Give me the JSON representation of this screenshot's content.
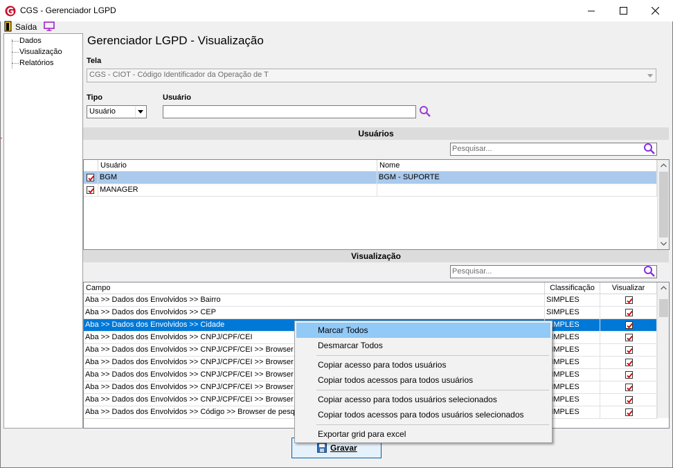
{
  "window": {
    "title": "CGS - Gerenciador LGPD"
  },
  "menu": {
    "exit_label": "Saída"
  },
  "tree": {
    "items": [
      "Dados",
      "Visualização",
      "Relatórios"
    ]
  },
  "page": {
    "title": "Gerenciador LGPD - Visualização"
  },
  "tela": {
    "label": "Tela",
    "value": "CGS - CIOT - Código Identificador da Operação de T"
  },
  "tipo": {
    "label": "Tipo",
    "value": "Usuário"
  },
  "usuario": {
    "label": "Usuário",
    "value": ""
  },
  "users_section": {
    "title": "Usuários",
    "search_placeholder": "Pesquisar...",
    "columns": [
      "Usuário",
      "Nome"
    ],
    "rows": [
      {
        "checked": true,
        "user": "BGM",
        "name": "BGM - SUPORTE"
      },
      {
        "checked": true,
        "user": "MANAGER",
        "name": ""
      }
    ]
  },
  "view_section": {
    "title": "Visualização",
    "search_placeholder": "Pesquisar...",
    "columns": [
      "Campo",
      "Classificação",
      "Visualizar"
    ],
    "rows": [
      {
        "campo": "Aba >> Dados dos Envolvidos >> Bairro",
        "classificacao": "SIMPLES",
        "visualizar": true
      },
      {
        "campo": "Aba >> Dados dos Envolvidos >> CEP",
        "classificacao": "SIMPLES",
        "visualizar": true
      },
      {
        "campo": "Aba >> Dados dos Envolvidos >> Cidade",
        "classificacao": "SIMPLES",
        "visualizar": true
      },
      {
        "campo": "Aba >> Dados dos Envolvidos >> CNPJ/CPF/CEI",
        "classificacao": "SIMPLES",
        "visualizar": true
      },
      {
        "campo": "Aba >> Dados dos Envolvidos >> CNPJ/CPF/CEI >> Browser de",
        "classificacao": "SIMPLES",
        "visualizar": true
      },
      {
        "campo": "Aba >> Dados dos Envolvidos >> CNPJ/CPF/CEI >> Browser de",
        "classificacao": "SIMPLES",
        "visualizar": true
      },
      {
        "campo": "Aba >> Dados dos Envolvidos >> CNPJ/CPF/CEI >> Browser de",
        "classificacao": "SIMPLES",
        "visualizar": true
      },
      {
        "campo": "Aba >> Dados dos Envolvidos >> CNPJ/CPF/CEI >> Browser de",
        "classificacao": "SIMPLES",
        "visualizar": true
      },
      {
        "campo": "Aba >> Dados dos Envolvidos >> CNPJ/CPF/CEI >> Browser de",
        "classificacao": "SIMPLES",
        "visualizar": true
      },
      {
        "campo": "Aba >> Dados dos Envolvidos >> Código >> Browser de pesquis",
        "classificacao": "SIMPLES",
        "visualizar": true
      }
    ]
  },
  "context_menu": {
    "items": [
      "Marcar Todos",
      "Desmarcar Todos",
      "Copiar acesso para todos usuários",
      "Copiar todos acessos para todos usuários",
      "Copiar acesso para todos usuários selecionados",
      "Copiar todos acessos para todos usuários selecionados",
      "Exportar grid para excel"
    ]
  },
  "save_button": {
    "label": "Gravar"
  },
  "colors": {
    "selection": "#0078d7",
    "selection_light": "#aac9ec",
    "menu_highlight": "#91c9f7",
    "check": "#cc0000",
    "search_icon": "#9b3fd0"
  }
}
